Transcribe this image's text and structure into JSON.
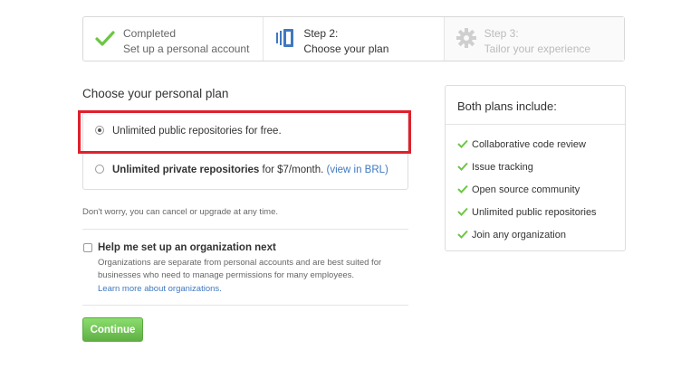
{
  "steps": [
    {
      "title": "Completed",
      "subtitle": "Set up a personal account",
      "icon": "check-icon",
      "state": "done"
    },
    {
      "title": "Step 2:",
      "subtitle": "Choose your plan",
      "icon": "plan-icon",
      "state": "current"
    },
    {
      "title": "Step 3:",
      "subtitle": "Tailor your experience",
      "icon": "gear-icon",
      "state": "future"
    }
  ],
  "plan": {
    "title": "Choose your personal plan",
    "options": [
      {
        "label": "Unlimited public repositories for free.",
        "selected": true
      },
      {
        "label_bold": "Unlimited private repositories",
        "label_rest": " for $7/month. ",
        "link": "(view in BRL)",
        "selected": false
      }
    ],
    "note": "Don't worry, you can cancel or upgrade at any time."
  },
  "org": {
    "label": "Help me set up an organization next",
    "desc_line1": "Organizations are separate from personal accounts and are best suited for",
    "desc_line2": "businesses who need to manage permissions for many employees.",
    "link": "Learn more about organizations."
  },
  "continue_label": "Continue",
  "panel": {
    "title": "Both plans include:",
    "items": [
      "Collaborative code review",
      "Issue tracking",
      "Open source community",
      "Unlimited public repositories",
      "Join any organization"
    ]
  },
  "colors": {
    "check_green": "#6cc644",
    "highlight_red": "#e0202b",
    "link_blue": "#4078c0",
    "button_green": "#60b044"
  }
}
